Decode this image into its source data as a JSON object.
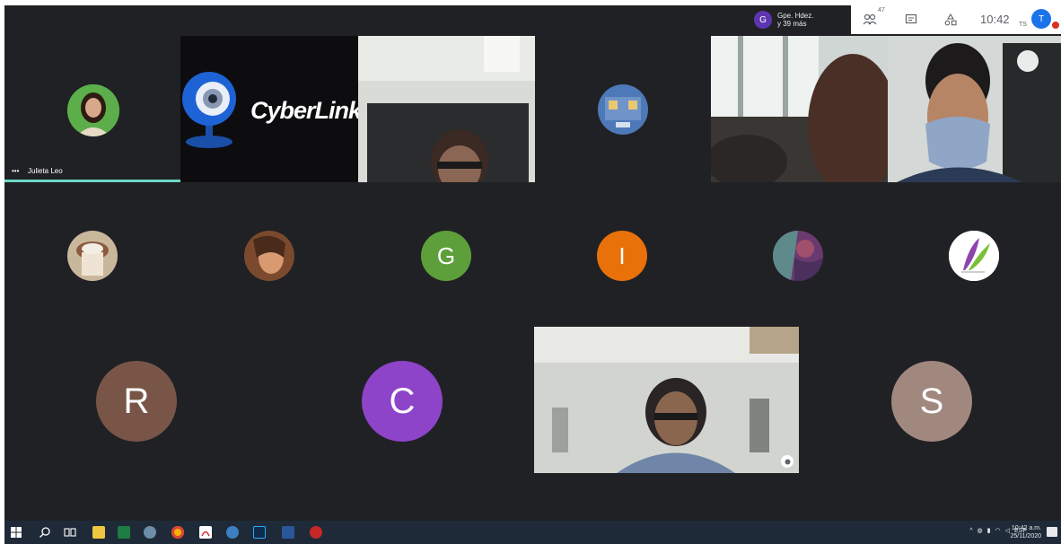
{
  "topbar": {
    "presenter_initial": "G",
    "presenter_line1": "Gpe. Hdez.",
    "presenter_line2": "y 39 más",
    "people_count_badge": "47",
    "clock": "10:42",
    "small_label": "TS",
    "user_initial": "T",
    "icons": [
      "people-icon",
      "chat-icon",
      "activities-icon"
    ]
  },
  "tiles": {
    "julieta_name": "Julieta Leo",
    "julieta_dots": "•••",
    "cyberlink_text": "CyberLink",
    "avatar_g": "G",
    "avatar_i": "I",
    "avatar_r": "R",
    "avatar_c": "C",
    "avatar_s": "S"
  },
  "colors": {
    "meet_bg": "#202124",
    "avatar_g": "#5d9f3b",
    "avatar_i": "#e8710a",
    "avatar_r": "#795548",
    "avatar_c": "#8e44c9",
    "avatar_s": "#a1887f",
    "speaking": "#6fd7c7"
  },
  "taskbar": {
    "clock_time": "10:42 a.m.",
    "clock_date": "25/11/2020",
    "lang": "ESP",
    "apps": [
      "windows-start-icon",
      "search-icon",
      "task-view-icon",
      "file-explorer-icon",
      "excel-icon",
      "edge-icon",
      "chrome-icon",
      "acrobat-icon",
      "app-icon",
      "photoshop-icon",
      "word-icon",
      "record-icon"
    ]
  }
}
